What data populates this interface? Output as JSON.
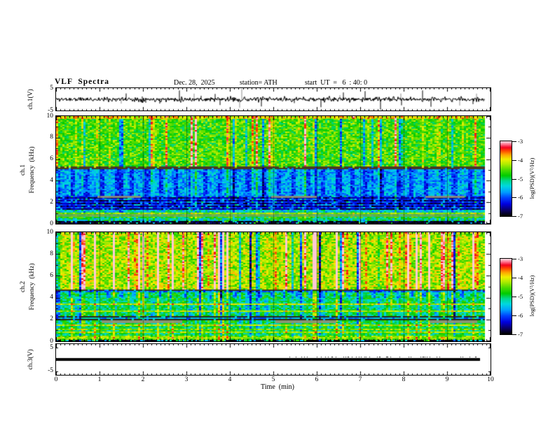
{
  "header": {
    "title": "VLF  Spectra",
    "date": "Dec. 28,  2025",
    "station": "station= ATH",
    "start_ut": "start  UT  =   6  : 40: 0"
  },
  "time_axis": {
    "label": "Time  (min)",
    "min": 0,
    "max": 10,
    "tick_labels": [
      "0",
      "1",
      "2",
      "3",
      "4",
      "5",
      "6",
      "7",
      "8",
      "9",
      "10"
    ],
    "minor_step_min": 0.1
  },
  "colorbar": {
    "label": "log(PSD)(V²/Hz)",
    "tick_labels": [
      "-3",
      "-4",
      "-5",
      "-6",
      "-7"
    ],
    "clim": [
      -7,
      -3
    ],
    "stops": [
      [
        0.0,
        "#000000"
      ],
      [
        0.07,
        "#0a0060"
      ],
      [
        0.16,
        "#0000e0"
      ],
      [
        0.24,
        "#0040ff"
      ],
      [
        0.32,
        "#00a0ff"
      ],
      [
        0.4,
        "#00d8e0"
      ],
      [
        0.47,
        "#00d890"
      ],
      [
        0.54,
        "#00cc00"
      ],
      [
        0.62,
        "#50dc00"
      ],
      [
        0.7,
        "#b4ec00"
      ],
      [
        0.76,
        "#f0f000"
      ],
      [
        0.82,
        "#ffa800"
      ],
      [
        0.875,
        "#ff4800"
      ],
      [
        0.92,
        "#f40020"
      ],
      [
        0.96,
        "#ff6e8a"
      ],
      [
        1.0,
        "#ffd6de"
      ]
    ]
  },
  "chart_data": [
    {
      "id": "ch1_voltage",
      "type": "line",
      "panel": "wave1",
      "ylabel": "ch.1(V)",
      "ylim": [
        -5,
        5
      ],
      "ytick_values": [
        5,
        -5
      ],
      "ytick_labels": [
        "5",
        "-5"
      ],
      "signal": {
        "mean_v": 0,
        "noise_v": 0.55,
        "spike_rate": 0.045,
        "spike_vmax": 4.8,
        "seed": 11
      },
      "color": "#000000"
    },
    {
      "id": "ch1_spectrogram",
      "type": "heatmap",
      "panel": "spec1",
      "ylabel_line1": "ch.1",
      "ylabel_line2": "Frequency  (kHz)",
      "ylim": [
        0,
        10
      ],
      "ytick_values": [
        10,
        8,
        6,
        4,
        2,
        0
      ],
      "ytick_labels": [
        "10",
        "8",
        "6",
        "4",
        "2",
        "0"
      ],
      "clim": [
        -7,
        -3
      ],
      "seed": 7,
      "streaks": {
        "density": 0.1,
        "amp": 1.35,
        "dark_density": 0.08,
        "dark_amp": 1.3
      },
      "bands": [
        {
          "f": [
            5.25,
            10
          ],
          "base": -4.6,
          "noise": 0.5,
          "streak_gain": 1.0
        },
        {
          "f": [
            2.6,
            5.25
          ],
          "base": -5.65,
          "noise": 0.42,
          "streak_gain": 0.45,
          "period": 7,
          "period_width": 2,
          "period_delta": -0.45
        },
        {
          "f": [
            1.25,
            2.6
          ],
          "base": -6.1,
          "noise": 0.3,
          "streak_gain": 0.3,
          "striped": true
        },
        {
          "f": [
            0.95,
            1.25
          ],
          "base": -5.4,
          "noise": 0.5,
          "streak_gain": 0.3
        },
        {
          "f": [
            0.55,
            0.95
          ],
          "base": -4.8,
          "noise": 0.45,
          "streak_gain": 0.25
        },
        {
          "f": [
            0.28,
            0.55
          ],
          "base": -5.2,
          "noise": 0.6,
          "streak_gain": 0.25
        },
        {
          "f": [
            0,
            0.28
          ],
          "base": -6.9,
          "noise": 0.25,
          "streak_gain": 0.15,
          "speckle": [
            0.17,
            -5.7,
            1.4
          ]
        }
      ],
      "stripes": [
        {
          "f": [
            9.78,
            10
          ],
          "psd": -4.0,
          "noise": 0.45
        },
        {
          "f": [
            5.12,
            5.28
          ],
          "color": "#4a3a22"
        },
        {
          "f": [
            0.95,
            1.06
          ],
          "psd": -4.35,
          "noise": 0.3
        }
      ],
      "gray_segments": [
        {
          "f": [
            2.42,
            2.62
          ],
          "x": [
            0.95,
            1.95
          ],
          "alpha": 0.9
        },
        {
          "f": [
            2.42,
            2.62
          ],
          "x": [
            4.95,
            6.0
          ],
          "alpha": 0.9
        },
        {
          "f": [
            2.42,
            2.62
          ],
          "x": [
            8.5,
            9.4
          ],
          "alpha": 0.9
        },
        {
          "f": [
            0.62,
            0.9
          ],
          "x": [
            0.02,
            9.85
          ],
          "alpha": 0.55
        }
      ]
    },
    {
      "id": "ch2_spectrogram",
      "type": "heatmap",
      "panel": "spec2",
      "ylabel_line1": "ch.2",
      "ylabel_line2": "Frequency  (kHz)",
      "ylim": [
        0,
        10
      ],
      "ytick_values": [
        10,
        8,
        6,
        4,
        2,
        0
      ],
      "ytick_labels": [
        "10",
        "8",
        "6",
        "4",
        "2",
        "0"
      ],
      "clim": [
        -7,
        -3
      ],
      "seed": 13,
      "streaks": {
        "density": 0.14,
        "amp": 1.5,
        "dark_density": 0.1,
        "dark_amp": 2.0
      },
      "bands": [
        {
          "f": [
            4.7,
            10
          ],
          "base": -4.25,
          "noise": 0.5,
          "streak_gain": 1.0
        },
        {
          "f": [
            4.45,
            4.7
          ],
          "base": -5.9,
          "noise": 0.4,
          "streak_gain": 0.6
        },
        {
          "f": [
            3.95,
            4.45
          ],
          "base": -5.0,
          "noise": 0.4,
          "streak_gain": 0.5,
          "period": 6,
          "period_width": 2,
          "period_delta": -0.75
        },
        {
          "f": [
            2.35,
            3.95
          ],
          "base": -5.05,
          "noise": 0.45,
          "streak_gain": 0.45,
          "period": 9,
          "period_width": 2,
          "period_delta": -0.4
        },
        {
          "f": [
            1.95,
            2.35
          ],
          "base": -5.6,
          "noise": 0.5,
          "streak_gain": 0.35
        },
        {
          "f": [
            0.5,
            1.95
          ],
          "base": -5.0,
          "noise": 0.5,
          "streak_gain": 0.35
        },
        {
          "f": [
            0.18,
            0.5
          ],
          "base": -4.5,
          "noise": 0.45,
          "streak_gain": 0.3
        },
        {
          "f": [
            0,
            0.18
          ],
          "base": -5.2,
          "noise": 0.6,
          "streak_gain": 0.2,
          "speckle": [
            0.5,
            -7.1,
            0.3
          ]
        }
      ],
      "stripes": [
        {
          "f": [
            4.6,
            4.76
          ],
          "color": "#3a3a20"
        },
        {
          "f": [
            3.3,
            3.5
          ],
          "psd": -4.15,
          "noise": 0.3
        },
        {
          "f": [
            2.7,
            2.88
          ],
          "psd": -4.3,
          "noise": 0.3
        },
        {
          "f": [
            2.2,
            2.3
          ],
          "color": "#2a2a18"
        },
        {
          "f": [
            1.96,
            2.06
          ],
          "color": "#2a2a18"
        },
        {
          "f": [
            1.45,
            1.6
          ],
          "psd": -4.2,
          "noise": 0.3
        },
        {
          "f": [
            1.05,
            1.18
          ],
          "psd": -4.45,
          "noise": 0.3
        },
        {
          "f": [
            0.78,
            0.9
          ],
          "psd": -4.3,
          "noise": 0.3
        },
        {
          "f": [
            0.3,
            0.42
          ],
          "psd": -4.3,
          "noise": 0.35
        }
      ],
      "gray_segments": [
        {
          "f": [
            1.68,
            1.92
          ],
          "x": [
            1.05,
            2.9
          ],
          "alpha": 0.9
        },
        {
          "f": [
            1.68,
            1.92
          ],
          "x": [
            5.05,
            6.45
          ],
          "alpha": 0.9
        },
        {
          "f": [
            1.68,
            1.92
          ],
          "x": [
            8.6,
            9.7
          ],
          "alpha": 0.9
        }
      ]
    },
    {
      "id": "ch3_voltage",
      "type": "line",
      "panel": "wave3",
      "ylabel": "ch.3(V)",
      "ylim": [
        -6.5,
        6.5
      ],
      "ytick_values": [
        5,
        -5
      ],
      "ytick_labels": [
        "5",
        "-5"
      ],
      "signal": {
        "mean_v": 0,
        "thickness_v": 1.1,
        "end_min": 9.75,
        "dot_segments": [
          [
            5.3,
            9.0
          ],
          [
            9.3,
            9.75
          ]
        ],
        "seed": 5
      },
      "color": "#000000"
    }
  ]
}
